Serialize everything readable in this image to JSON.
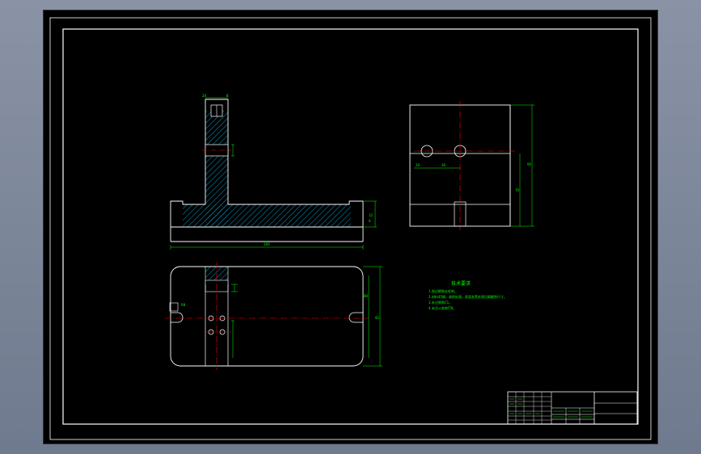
{
  "drawing": {
    "colors": {
      "outline": "#ffffff",
      "dimension": "#00ff00",
      "centerline": "#ff0000",
      "hatch": "#00a0c8",
      "background": "#000000"
    },
    "notes": {
      "title": "技术要求",
      "lines": [
        "1.锐边倒角去毛刺。",
        "2.材料45钢，调质处理，表面发黑处理后精磨到尺寸。",
        "3.未注倒角C1。",
        "4.未注公差按IT8。"
      ]
    },
    "dimensions": {
      "front_top_width": "24",
      "front_slot": "8",
      "front_base_height": "12",
      "front_base_step": "6",
      "front_overall_width": "160",
      "side_overall_height": "95",
      "side_inner_height": "70",
      "side_hole_pitch_1": "20",
      "side_hole_pitch_2": "30",
      "top_width_label": "R8",
      "top_height_label": "80",
      "top_overall_height": "85"
    },
    "title_block": {
      "cells": [
        "",
        "",
        "",
        "",
        "",
        ""
      ]
    }
  }
}
